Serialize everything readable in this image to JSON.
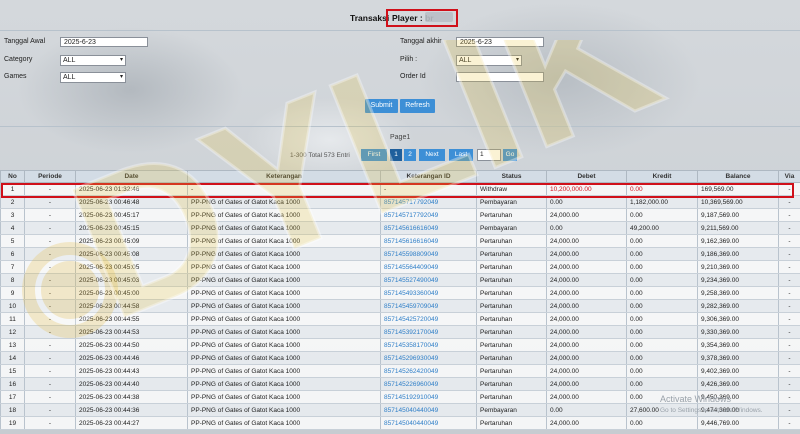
{
  "header": {
    "title_label": "Transaksi",
    "player_label": "Player : br"
  },
  "filters": {
    "tanggal_awal_label": "Tanggal Awal",
    "tanggal_awal_value": "2025-6-23",
    "category_label": "Category",
    "category_value": "ALL",
    "games_label": "Games",
    "games_value": "ALL",
    "tanggal_akhir_label": "Tanggal akhir",
    "tanggal_akhir_value": "2025-6-23",
    "pilih_label": "Pilih :",
    "pilih_value": "ALL",
    "order_id_label": "Order Id",
    "order_id_value": ""
  },
  "buttons": {
    "submit": "Submit",
    "refresh": "Refresh"
  },
  "pagination": {
    "page_label": "Page1",
    "total_label": "1-300 Total 573 Entri",
    "first": "First",
    "page1": "1",
    "page2": "2",
    "next": "Next",
    "last": "Last",
    "page_input": "1",
    "go": "Go"
  },
  "table": {
    "columns": [
      "No",
      "Periode",
      "Date",
      "Keterangan",
      "Keterangan ID",
      "Status",
      "Debet",
      "Kredit",
      "Balance",
      "Via"
    ],
    "rows": [
      [
        "1",
        "-",
        "2025-06-23 01:32:46",
        "-",
        "-",
        "Withdraw",
        "10,200,000.00",
        "0.00",
        "169,569.00",
        "-"
      ],
      [
        "2",
        "-",
        "2025-06-23 00:46:48",
        "PP-PNG of Gates of Gatot Kaca 1000",
        "857145717792049",
        "Pembayaran",
        "0.00",
        "1,182,000.00",
        "10,369,569.00",
        "-"
      ],
      [
        "3",
        "-",
        "2025-06-23 00:45:17",
        "PP-PNG of Gates of Gatot Kaca 1000",
        "857145717792049",
        "Pertaruhan",
        "24,000.00",
        "0.00",
        "9,187,569.00",
        "-"
      ],
      [
        "4",
        "-",
        "2025-06-23 00:45:15",
        "PP-PNG of Gates of Gatot Kaca 1000",
        "857145616616049",
        "Pembayaran",
        "0.00",
        "49,200.00",
        "9,211,569.00",
        "-"
      ],
      [
        "5",
        "-",
        "2025-06-23 00:45:09",
        "PP-PNG of Gates of Gatot Kaca 1000",
        "857145616616049",
        "Pertaruhan",
        "24,000.00",
        "0.00",
        "9,162,369.00",
        "-"
      ],
      [
        "6",
        "-",
        "2025-06-23 00:45:08",
        "PP-PNG of Gates of Gatot Kaca 1000",
        "857145598809049",
        "Pertaruhan",
        "24,000.00",
        "0.00",
        "9,186,369.00",
        "-"
      ],
      [
        "7",
        "-",
        "2025-06-23 00:45:05",
        "PP-PNG of Gates of Gatot Kaca 1000",
        "857145564409049",
        "Pertaruhan",
        "24,000.00",
        "0.00",
        "9,210,369.00",
        "-"
      ],
      [
        "8",
        "-",
        "2025-06-23 00:45:03",
        "PP-PNG of Gates of Gatot Kaca 1000",
        "857145527490049",
        "Pertaruhan",
        "24,000.00",
        "0.00",
        "9,234,369.00",
        "-"
      ],
      [
        "9",
        "-",
        "2025-06-23 00:45:00",
        "PP-PNG of Gates of Gatot Kaca 1000",
        "857145493360049",
        "Pertaruhan",
        "24,000.00",
        "0.00",
        "9,258,369.00",
        "-"
      ],
      [
        "10",
        "-",
        "2025-06-23 00:44:58",
        "PP-PNG of Gates of Gatot Kaca 1000",
        "857145459709049",
        "Pertaruhan",
        "24,000.00",
        "0.00",
        "9,282,369.00",
        "-"
      ],
      [
        "11",
        "-",
        "2025-06-23 00:44:55",
        "PP-PNG of Gates of Gatot Kaca 1000",
        "857145425720049",
        "Pertaruhan",
        "24,000.00",
        "0.00",
        "9,306,369.00",
        "-"
      ],
      [
        "12",
        "-",
        "2025-06-23 00:44:53",
        "PP-PNG of Gates of Gatot Kaca 1000",
        "857145392170049",
        "Pertaruhan",
        "24,000.00",
        "0.00",
        "9,330,369.00",
        "-"
      ],
      [
        "13",
        "-",
        "2025-06-23 00:44:50",
        "PP-PNG of Gates of Gatot Kaca 1000",
        "857145358170049",
        "Pertaruhan",
        "24,000.00",
        "0.00",
        "9,354,369.00",
        "-"
      ],
      [
        "14",
        "-",
        "2025-06-23 00:44:46",
        "PP-PNG of Gates of Gatot Kaca 1000",
        "857145296930049",
        "Pertaruhan",
        "24,000.00",
        "0.00",
        "9,378,369.00",
        "-"
      ],
      [
        "15",
        "-",
        "2025-06-23 00:44:43",
        "PP-PNG of Gates of Gatot Kaca 1000",
        "857145262420049",
        "Pertaruhan",
        "24,000.00",
        "0.00",
        "9,402,369.00",
        "-"
      ],
      [
        "16",
        "-",
        "2025-06-23 00:44:40",
        "PP-PNG of Gates of Gatot Kaca 1000",
        "857145226960049",
        "Pertaruhan",
        "24,000.00",
        "0.00",
        "9,426,369.00",
        "-"
      ],
      [
        "17",
        "-",
        "2025-06-23 00:44:38",
        "PP-PNG of Gates of Gatot Kaca 1000",
        "857145192910049",
        "Pertaruhan",
        "24,000.00",
        "0.00",
        "9,450,369.00",
        "-"
      ],
      [
        "18",
        "-",
        "2025-06-23 00:44:36",
        "PP-PNG of Gates of Gatot Kaca 1000",
        "857145040440049",
        "Pembayaran",
        "0.00",
        "27,600.00",
        "9,474,369.00",
        "-"
      ],
      [
        "19",
        "-",
        "2025-06-23 00:44:27",
        "PP-PNG of Gates of Gatot Kaca 1000",
        "857145040440049",
        "Pertaruhan",
        "24,000.00",
        "0.00",
        "9,446,769.00",
        "-"
      ]
    ]
  },
  "watermark": {
    "text": "DYLIK"
  },
  "os_notice": {
    "title": "Activate Windows",
    "subtitle": "Go to Settings to activate Windows."
  },
  "colors": {
    "accent": "#3d8fd6",
    "highlight": "#d0101a",
    "link": "#2f7fc8"
  }
}
